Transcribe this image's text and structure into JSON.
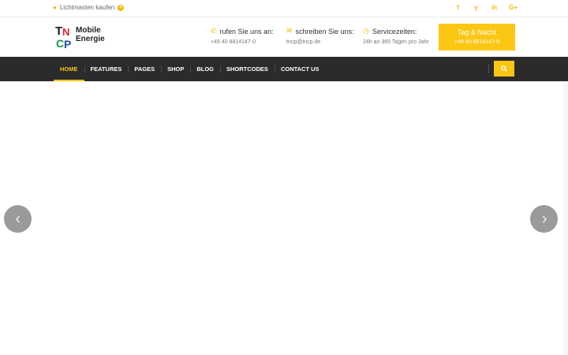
{
  "topbar": {
    "promo_text": "Lichtmasten kaufen",
    "social": [
      {
        "icon": "facebook-icon",
        "glyph": "f"
      },
      {
        "icon": "twitter-icon",
        "glyph": "y"
      },
      {
        "icon": "linkedin-icon",
        "glyph": "in"
      },
      {
        "icon": "google-plus-icon",
        "glyph": "G+"
      }
    ]
  },
  "logo": {
    "line1": "Mobile",
    "line2": "Energie",
    "letters": [
      "T",
      "N",
      "C",
      "P"
    ]
  },
  "contacts": [
    {
      "icon": "phone-icon",
      "title": "rufen Sie uns an:",
      "sub": "+49 40 8814147-0"
    },
    {
      "icon": "envelope-icon",
      "title": "schreiben Sie uns:",
      "sub": "tncp@tncp.de"
    },
    {
      "icon": "clock-icon",
      "title": "Servicezeiten:",
      "sub": "24h an 365 Tagen pro Jahr"
    }
  ],
  "cta": {
    "line1": "Tag & Nacht",
    "line2": "+49 40 8814147-0"
  },
  "nav": {
    "items": [
      "HOME",
      "FEATURES",
      "PAGES",
      "SHOP",
      "BLOG",
      "SHORTCODES",
      "CONTACT US"
    ],
    "active_index": 0
  },
  "colors": {
    "accent": "#fcc614",
    "nav_bg": "#2b2b2b",
    "arrow_bg": "#9a9a9a"
  }
}
